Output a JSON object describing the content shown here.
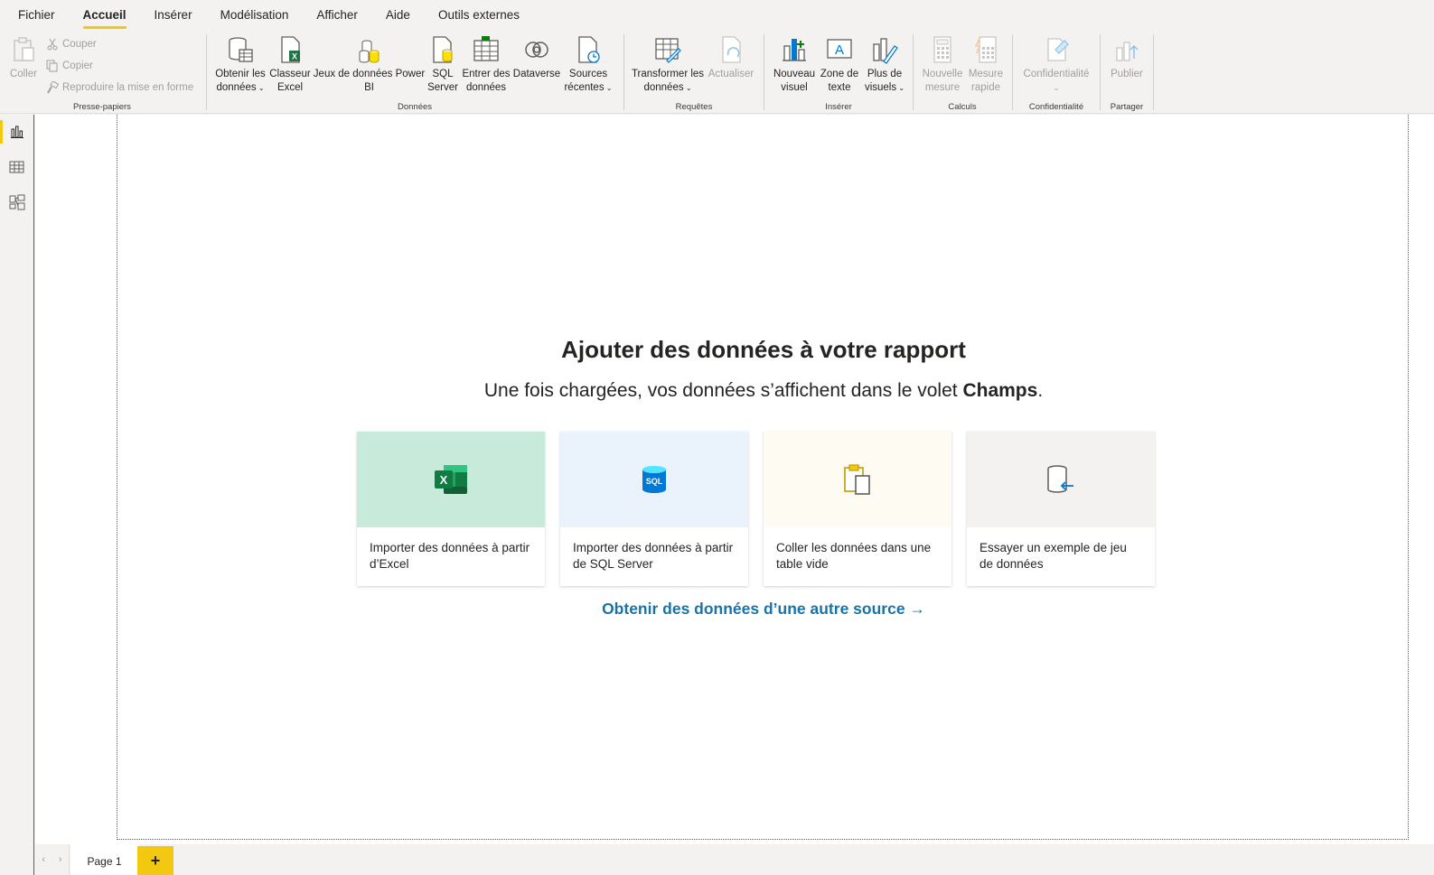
{
  "menu": [
    "Fichier",
    "Accueil",
    "Insérer",
    "Modélisation",
    "Afficher",
    "Aide",
    "Outils externes"
  ],
  "ribbon": {
    "clipboard": {
      "paste": "Coller",
      "cut": "Couper",
      "copy": "Copier",
      "format_painter": "Reproduire la mise en forme",
      "group_label": "Presse-papiers"
    },
    "data": {
      "get_data_1": "Obtenir les",
      "get_data_2": "données",
      "excel_1": "Classeur",
      "excel_2": "Excel",
      "pbi_datasets_1": "Jeux de données Power",
      "pbi_datasets_2": "BI",
      "sql_1": "SQL",
      "sql_2": "Server",
      "enter_data_1": "Entrer des",
      "enter_data_2": "données",
      "dataverse": "Dataverse",
      "recent_1": "Sources",
      "recent_2": "récentes",
      "group_label": "Données"
    },
    "queries": {
      "transform_1": "Transformer les",
      "transform_2": "données",
      "refresh": "Actualiser",
      "group_label": "Requêtes"
    },
    "insert": {
      "new_visual_1": "Nouveau",
      "new_visual_2": "visuel",
      "textbox_1": "Zone de",
      "textbox_2": "texte",
      "more_visuals_1": "Plus de",
      "more_visuals_2": "visuels",
      "group_label": "Insérer"
    },
    "calc": {
      "new_measure_1": "Nouvelle",
      "new_measure_2": "mesure",
      "quick_measure_1": "Mesure",
      "quick_measure_2": "rapide",
      "group_label": "Calculs"
    },
    "sensitivity": {
      "label": "Confidentialité",
      "group_label": "Confidentialité"
    },
    "share": {
      "publish": "Publier",
      "group_label": "Partager"
    }
  },
  "canvas": {
    "title": "Ajouter des données à votre rapport",
    "subtitle_pre": "Une fois chargées, vos données s’affichent dans le volet ",
    "subtitle_bold": "Champs",
    "subtitle_post": ".",
    "cards": [
      {
        "label": "Importer des données à partir d’Excel",
        "bg": "#c8eadb"
      },
      {
        "label": "Importer des données à partir de SQL Server",
        "bg": "#eaf3fb"
      },
      {
        "label": "Coller les données dans une table vide",
        "bg": "#fefcf2"
      },
      {
        "label": "Essayer un exemple de jeu de données",
        "bg": "#f3f2f1"
      }
    ],
    "other_source_link": "Obtenir des données d’une autre source →",
    "sql_badge": "SQL",
    "excel_badge": "X"
  },
  "pages": {
    "tab": "Page 1",
    "add": "+"
  },
  "colors": {
    "accent": "#f2c811",
    "link": "#1a73a8"
  }
}
